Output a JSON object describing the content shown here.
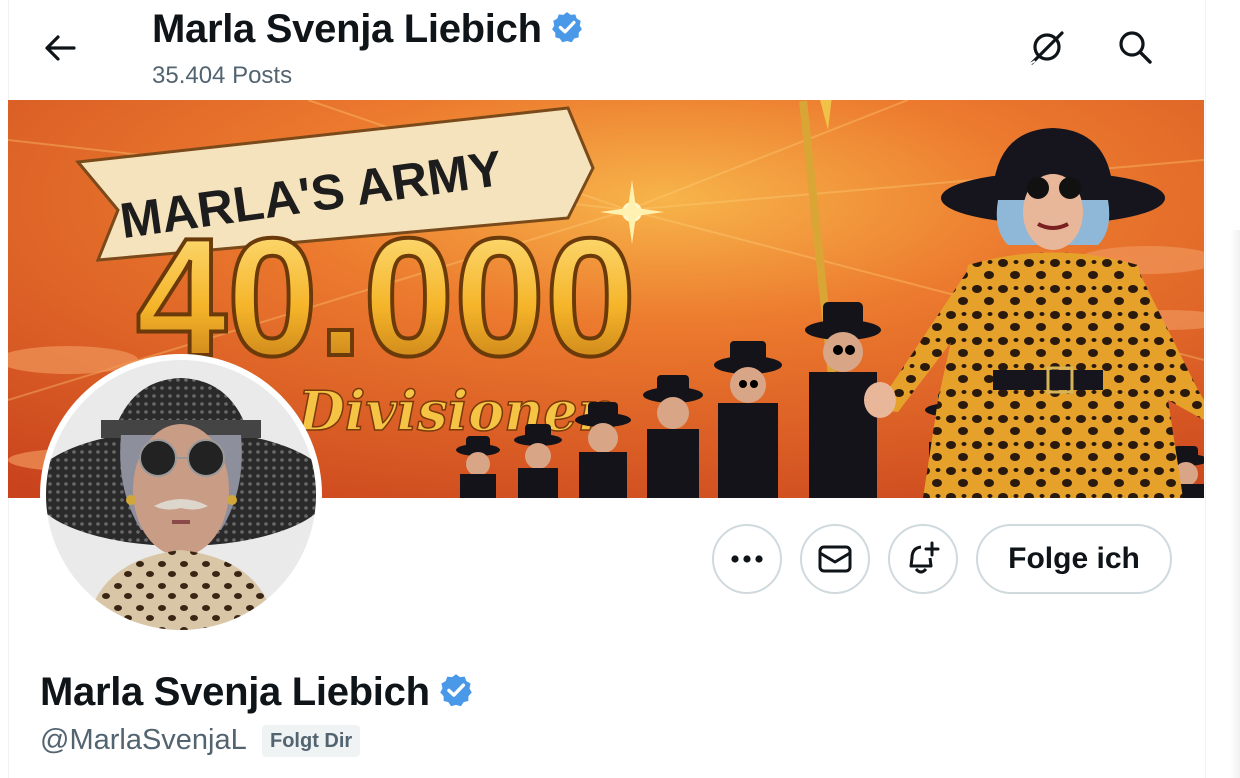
{
  "header": {
    "display_name": "Marla Svenja Liebich",
    "posts_count": "35.404 Posts"
  },
  "banner": {
    "headline": "MARLA'S ARMY",
    "number": "40.000",
    "subtitle": "Divisionen"
  },
  "actions": {
    "more_label": "•••",
    "follow_back_label": "Folge ich"
  },
  "profile": {
    "display_name": "Marla Svenja Liebich",
    "handle": "@MarlaSvenjaL",
    "follows_you_label": "Folgt Dir"
  },
  "colors": {
    "verified_blue": "#4a99e9",
    "text_primary": "#0f1419",
    "text_secondary": "#536471",
    "border": "#cfd9de"
  },
  "icons": {
    "back": "arrow-left-icon",
    "grok": "grok-icon",
    "search": "search-icon",
    "more": "more-icon",
    "message": "envelope-icon",
    "notify": "bell-plus-icon",
    "verified": "verified-badge-icon"
  }
}
